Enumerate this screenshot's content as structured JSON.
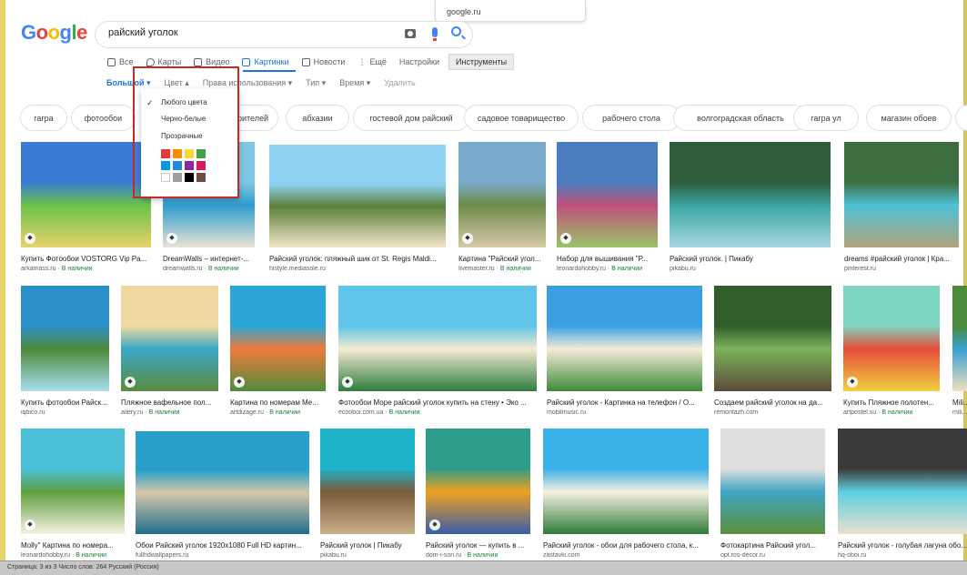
{
  "browser": {
    "url_suggestion": "google.ru"
  },
  "logo": {
    "letters": [
      "G",
      "o",
      "o",
      "g",
      "l",
      "e"
    ]
  },
  "search": {
    "query": "райский уголок"
  },
  "tabs": [
    {
      "label": "Все",
      "icon": "search-icon"
    },
    {
      "label": "Карты",
      "icon": "map-pin-icon"
    },
    {
      "label": "Видео",
      "icon": "video-icon"
    },
    {
      "label": "Картинки",
      "icon": "image-icon",
      "active": true
    },
    {
      "label": "Новости",
      "icon": "news-icon"
    },
    {
      "label": "Ещё",
      "icon": "more-icon"
    },
    {
      "label": "Настройки"
    },
    {
      "label": "Инструменты"
    }
  ],
  "tools": {
    "size": "Большой ▾",
    "color": "Цвет ▴",
    "rights": "Права использования ▾",
    "type": "Тип ▾",
    "time": "Время ▾",
    "clear": "Удалить"
  },
  "color_menu": {
    "any_color": "Любого цвета",
    "black_white": "Черно-белые",
    "transparent": "Прозрачные",
    "swatches": [
      "#e53935",
      "#fb8c00",
      "#fdd835",
      "#43a047",
      "#039be5",
      "#1e88e5",
      "#8e24aa",
      "#d81b60",
      "#ffffff",
      "#9e9e9e",
      "#000000",
      "#6d4c41"
    ]
  },
  "chips": [
    "гагра",
    "фотообои",
    "",
    "абхазии",
    "гостевой дом райский",
    "садовое товарищество",
    "рабочего стола",
    "волгоградская область",
    "гагра ул",
    "магазин обоев",
    "тов"
  ],
  "chip_partial_under_menu": "рителей",
  "results": [
    {
      "caption": "Купить Фотообои VOSTORG Vip Pa...",
      "source": "arkamass.ru",
      "stock": "В наличии",
      "colors": [
        "#3a7bd5",
        "#6cc24a",
        "#e8d36b"
      ]
    },
    {
      "caption": "DreamWalls – интернет-...",
      "source": "dreamwalls.ru",
      "stock": "В наличии",
      "colors": [
        "#7ec8e3",
        "#2e9ccf",
        "#e9e4d4"
      ]
    },
    {
      "caption": "Райский уголок: пляжный шик от St. Regis Maldi...",
      "source": "histyle.mediasole.ru",
      "stock": "",
      "colors": [
        "#8fd3f4",
        "#5a7f3a",
        "#f3e5c8"
      ]
    },
    {
      "caption": "Картина \"Райский угол...",
      "source": "livemaster.ru",
      "stock": "В наличии",
      "colors": [
        "#7aa9c9",
        "#6d8c4b",
        "#d8c9a8"
      ]
    },
    {
      "caption": "Набор для вышивания \"Р...",
      "source": "leonardohobby.ru",
      "stock": "В наличии",
      "colors": [
        "#4a7dbd",
        "#c0507a",
        "#9ac46a"
      ]
    },
    {
      "caption": "Райский уголок. | Пикабу",
      "source": "pikabu.ru",
      "stock": "",
      "colors": [
        "#2e5d3a",
        "#3ba5a0",
        "#a8d8e0"
      ]
    },
    {
      "caption": "dreams #райский уголок | Кра...",
      "source": "pinterest.ru",
      "stock": "",
      "colors": [
        "#3b6d3f",
        "#4ec2d6",
        "#b0a27a"
      ]
    },
    {
      "caption": "Купить фотообои Райск...",
      "source": "iqbico.ru",
      "stock": "",
      "colors": [
        "#2b8fc9",
        "#4e8a3a",
        "#a9dff0"
      ]
    },
    {
      "caption": "Пляжное вафельное пол...",
      "source": "ailery.ru",
      "stock": "В наличии",
      "colors": [
        "#f0d9a0",
        "#3ba8c8",
        "#5b8b3c"
      ]
    },
    {
      "caption": "Картина по номерам Ме...",
      "source": "artdizage.ru",
      "stock": "В наличии",
      "colors": [
        "#2aa7d6",
        "#ef7a3a",
        "#4f8c3e"
      ]
    },
    {
      "caption": "Фотообои Море райский уголок купить на стену • Эко ...",
      "source": "ecooboi.com.ua",
      "stock": "В наличии",
      "colors": [
        "#5ec4e8",
        "#f3ead2",
        "#2f7d3c"
      ]
    },
    {
      "caption": "Райский уголок - Картинка на телефон / О...",
      "source": "mobilmusic.ru",
      "stock": "",
      "colors": [
        "#3aa0e0",
        "#f5ecd8",
        "#3d8a3a"
      ]
    },
    {
      "caption": "Создаем райский уголок на да...",
      "source": "remontazh.com",
      "stock": "",
      "colors": [
        "#2f5e2a",
        "#7bb25a",
        "#5a4a3a"
      ]
    },
    {
      "caption": "Купить Пляжное полотен...",
      "source": "artpostel.su",
      "stock": "В наличии",
      "colors": [
        "#7fd6c0",
        "#e84d3a",
        "#f0d040"
      ]
    },
    {
      "caption": "Molly\" Картина по номера...",
      "source": "leonardohobby.ru",
      "stock": "В наличии",
      "colors": [
        "#49c0d8",
        "#5fa040",
        "#f7f2e2"
      ]
    },
    {
      "caption": "Обои Райский уголок 1920x1080 Full HD картин...",
      "source": "fullhdwallpapers.ru",
      "stock": "",
      "colors": [
        "#2a9fc9",
        "#d6c7a8",
        "#1f6d8c"
      ]
    },
    {
      "caption": "Райский уголок | Пикабу",
      "source": "pikabu.ru",
      "stock": "",
      "colors": [
        "#1fb3c8",
        "#7a5a3a",
        "#c9b089"
      ]
    },
    {
      "caption": "Райский уголок — купить в ...",
      "source": "dom-i-son.ru",
      "stock": "В наличии",
      "colors": [
        "#2e9c8a",
        "#f0a020",
        "#3a5ea8"
      ]
    },
    {
      "caption": "Райский уголок - обои для рабочего стола, к...",
      "source": "zastavki.com",
      "stock": "",
      "colors": [
        "#3ab0e8",
        "#f5f0e0",
        "#2f7a3a"
      ]
    },
    {
      "caption": "Фотокартина Райский угол...",
      "source": "opt.ros-decor.ru",
      "stock": "",
      "colors": [
        "#dedede",
        "#3fa5c4",
        "#5a8f3a"
      ]
    },
    {
      "caption": "Райский уголок - голубая лагуна обои...",
      "source": "hq-oboi.ru",
      "stock": "",
      "colors": [
        "#3a3a3a",
        "#5fd0e0",
        "#e8e0d0"
      ]
    },
    {
      "caption": "Mili...",
      "source": "mili...",
      "stock": "",
      "colors": [
        "#4a8a3a",
        "#3aa0d0",
        "#f0e0c0"
      ]
    }
  ],
  "taskbar": {
    "text": "Страница: 3 из 3     Число слов: 264     Русский (Россия)"
  }
}
